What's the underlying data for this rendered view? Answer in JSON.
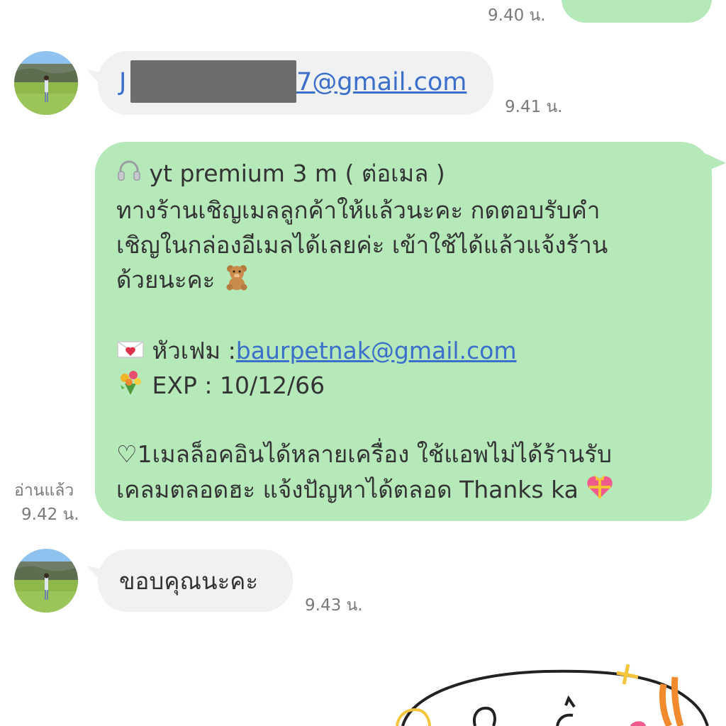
{
  "messages": {
    "m0": {
      "time": "9.40 น."
    },
    "m1": {
      "email_start": "J",
      "email_end": "7@gmail.com",
      "time": "9.41 น."
    },
    "m2": {
      "line1": "yt premium 3 m ( ต่อเมล )",
      "line2": "ทางร้านเชิญเมลลูกค้าให้แล้วนะคะ กดตอบรับคำ",
      "line3": "เชิญในกล่องอีเมลได้เลยค่ะ  เข้าใช้ได้แล้วแจ้งร้าน",
      "line4": "ด้วยนะคะ",
      "head_label": "หัวเฟม :",
      "head_email": "baurpetnak@gmail.com",
      "exp": "EXP : 10/12/66",
      "line7": "♡1เมลล็อคอินได้หลายเครื่อง ใช้แอพไม่ได้ร้านรับ",
      "line8": "เคลมตลอดฮะ แจ้งปัญหาได้ตลอด Thanks ka",
      "read": "อ่านแล้ว",
      "time": "9.42 น."
    },
    "m3": {
      "text": "ขอบคุณนะคะ",
      "time": "9.43 น."
    }
  },
  "icons": {
    "headphones": "headphones-icon",
    "teddy": "teddy-bear-icon",
    "envelope": "envelope-heart-icon",
    "flowers": "bouquet-icon",
    "gift_heart": "gift-heart-icon"
  },
  "colors": {
    "sent_bubble": "#b6e9ba",
    "received_bubble": "#f0f1f3",
    "link": "#3b6fc9",
    "timestamp": "#7a7a7a"
  }
}
